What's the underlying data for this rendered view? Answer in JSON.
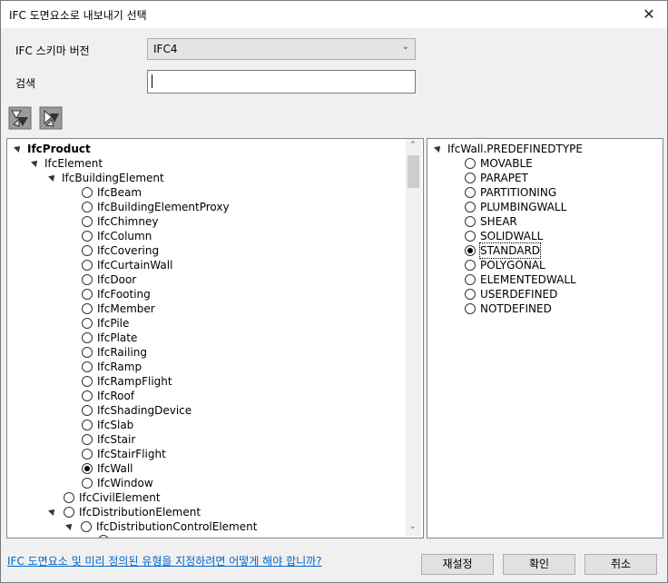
{
  "window": {
    "title": "IFC 도면요소로 내보내기 선택",
    "close_glyph": "✕"
  },
  "form": {
    "schema_label": "IFC 스키마 버전",
    "schema_value": "IFC4",
    "search_label": "검색",
    "search_value": ""
  },
  "toolbar": {
    "expand_icon": "expand-all-icon",
    "collapse_icon": "collapse-all-icon"
  },
  "left_tree": {
    "root": "IfcProduct",
    "element": "IfcElement",
    "building_element": "IfcBuildingElement",
    "items": [
      "IfcBeam",
      "IfcBuildingElementProxy",
      "IfcChimney",
      "IfcColumn",
      "IfcCovering",
      "IfcCurtainWall",
      "IfcDoor",
      "IfcFooting",
      "IfcMember",
      "IfcPile",
      "IfcPlate",
      "IfcRailing",
      "IfcRamp",
      "IfcRampFlight",
      "IfcRoof",
      "IfcShadingDevice",
      "IfcSlab",
      "IfcStair",
      "IfcStairFlight",
      "IfcWall",
      "IfcWindow"
    ],
    "selected": "IfcWall",
    "civil_element": "IfcCivilElement",
    "distribution_element": "IfcDistributionElement",
    "distribution_control_element": "IfcDistributionControlElement"
  },
  "right_tree": {
    "root": "IfcWall.PREDEFINEDTYPE",
    "items": [
      "MOVABLE",
      "PARAPET",
      "PARTITIONING",
      "PLUMBINGWALL",
      "SHEAR",
      "SOLIDWALL",
      "STANDARD",
      "POLYGONAL",
      "ELEMENTEDWALL",
      "USERDEFINED",
      "NOTDEFINED"
    ],
    "selected": "STANDARD"
  },
  "footer": {
    "help_link": "IFC 도면요소 및 미리 정의된 유형을 지정하려면 어떻게 해야 합니까?",
    "reset": "재설정",
    "ok": "확인",
    "cancel": "취소"
  }
}
